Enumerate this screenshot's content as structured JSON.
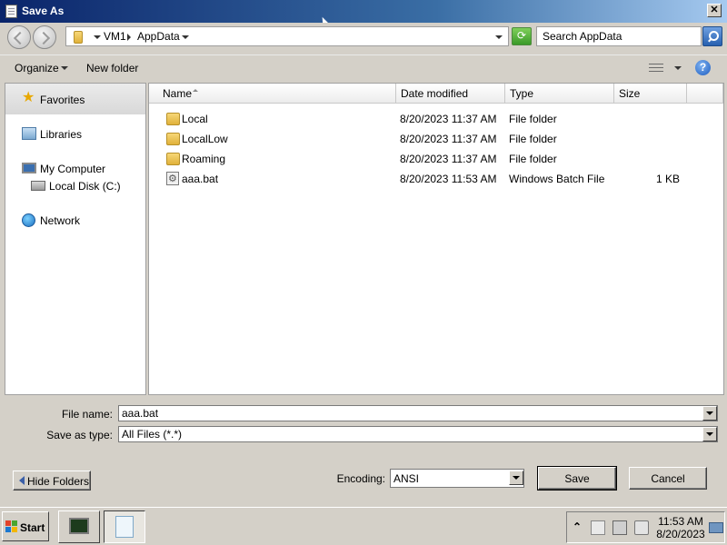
{
  "window": {
    "title": "Save As",
    "close_glyph": "✕"
  },
  "address": {
    "crumbs": [
      "VM1",
      "AppData"
    ],
    "search_placeholder": "Search AppData",
    "refresh_glyph": "⟳"
  },
  "toolbar": {
    "organize": "Organize",
    "new_folder": "New folder",
    "help_glyph": "?"
  },
  "navpane": {
    "items": [
      {
        "label": "Favorites",
        "icon": "star-icon"
      },
      {
        "label": "Libraries",
        "icon": "libraries-icon"
      },
      {
        "label": "My Computer",
        "icon": "computer-icon"
      },
      {
        "label": "Local Disk (C:)",
        "icon": "disk-icon"
      },
      {
        "label": "Network",
        "icon": "network-icon"
      }
    ],
    "star_glyph": "★"
  },
  "list": {
    "columns": [
      "Name",
      "Date modified",
      "Type",
      "Size"
    ],
    "rows": [
      {
        "name": "Local",
        "date": "8/20/2023 11:37 AM",
        "type": "File folder",
        "size": "",
        "icon": "folder-icon"
      },
      {
        "name": "LocalLow",
        "date": "8/20/2023 11:37 AM",
        "type": "File folder",
        "size": "",
        "icon": "folder-icon"
      },
      {
        "name": "Roaming",
        "date": "8/20/2023 11:37 AM",
        "type": "File folder",
        "size": "",
        "icon": "folder-icon"
      },
      {
        "name": "aaa.bat",
        "date": "8/20/2023 11:53 AM",
        "type": "Windows Batch File",
        "size": "1 KB",
        "icon": "batch-file-icon"
      }
    ]
  },
  "form": {
    "file_name_label": "File name:",
    "file_name_value": "aaa.bat",
    "save_type_label": "Save as type:",
    "save_type_value": "All Files  (*.*)",
    "encoding_label": "Encoding:",
    "encoding_value": "ANSI",
    "save_button": "Save",
    "cancel_button": "Cancel",
    "hide_folders": "Hide Folders"
  },
  "taskbar": {
    "start": "Start",
    "time": "11:53 AM",
    "date": "8/20/2023",
    "tray_expand_glyph": "⌃"
  },
  "colors": {
    "titlebar_start": "#0a246a",
    "titlebar_end": "#a6caf0",
    "chrome": "#d4d0c8"
  }
}
